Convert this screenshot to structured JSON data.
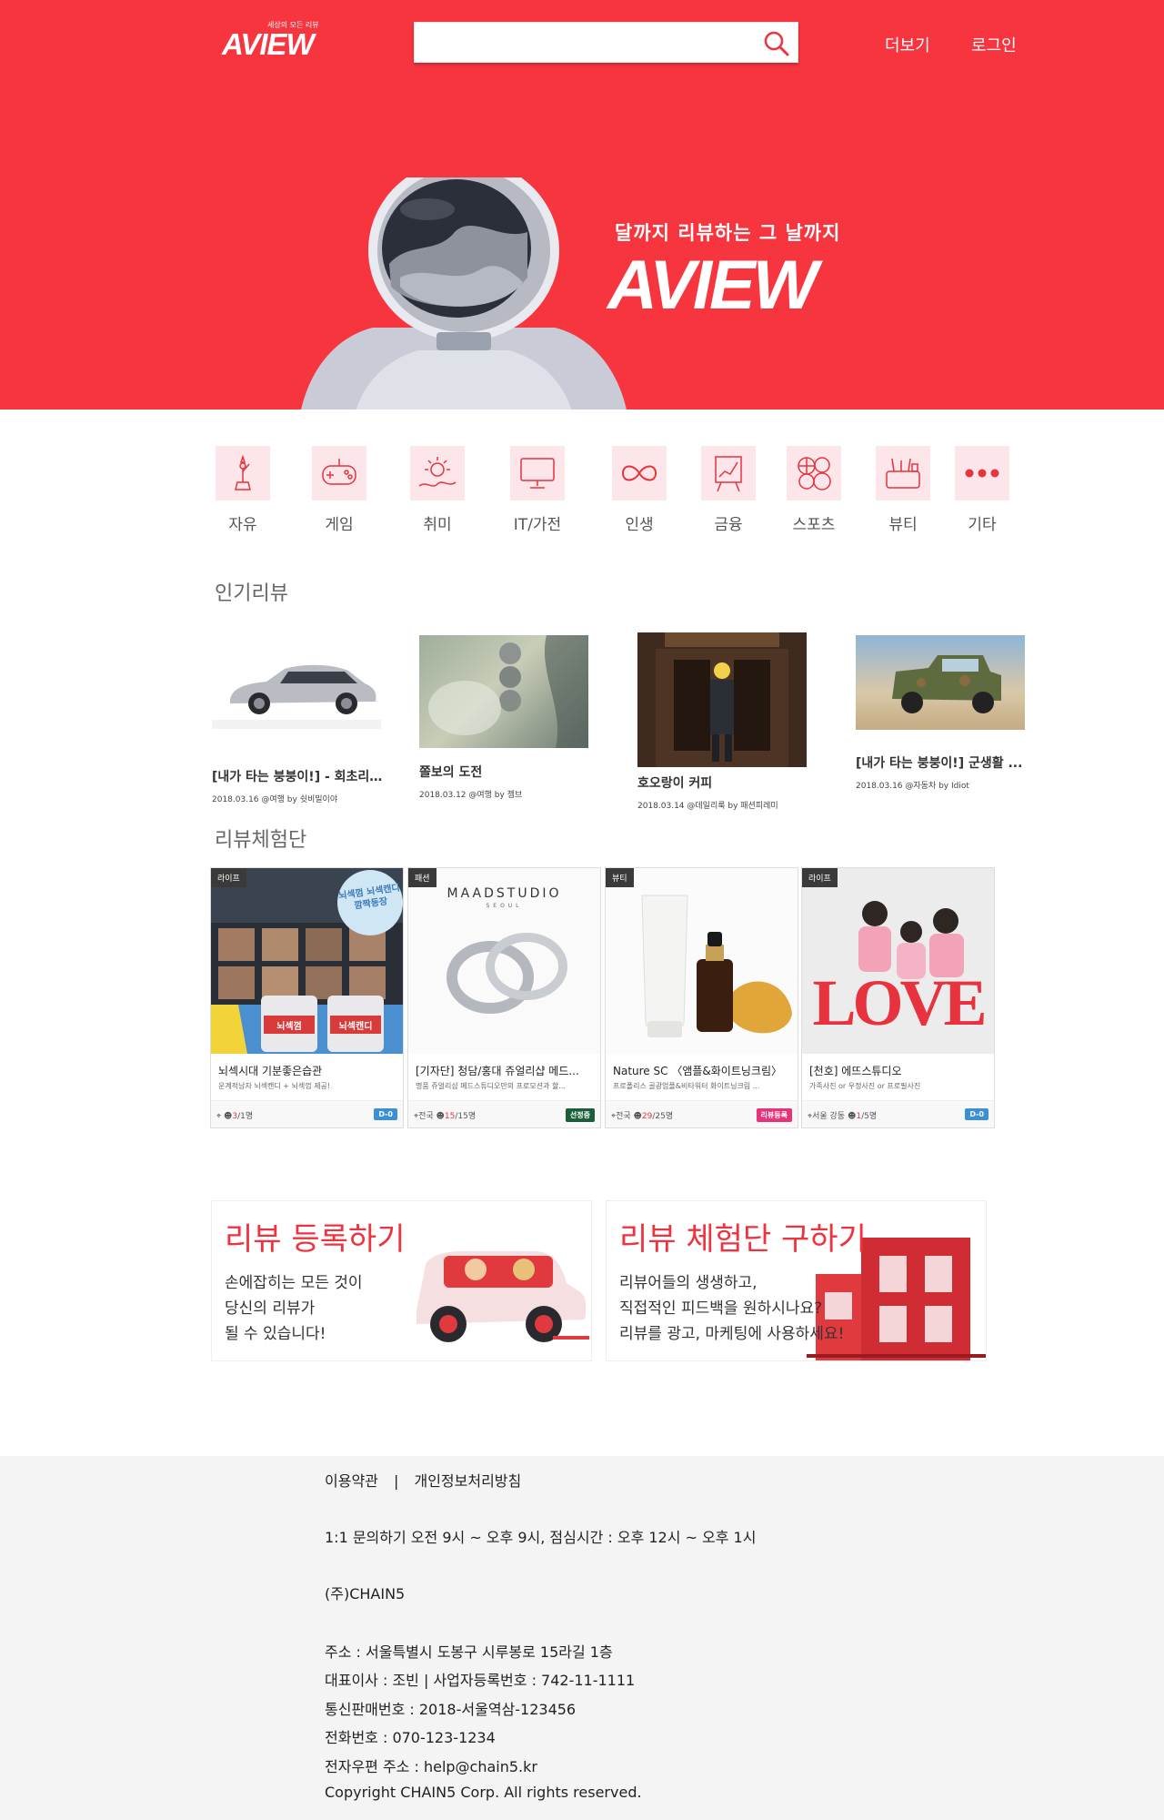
{
  "header": {
    "logo_text": "AVIEW",
    "logo_tagline": "세상의 모든 리뷰",
    "search_placeholder": "",
    "more_label": "더보기",
    "login_label": "로그인"
  },
  "hero": {
    "tagline": "달까지 리뷰하는 그 날까지",
    "logo_text": "AVIEW"
  },
  "categories": [
    {
      "label": "자유",
      "icon": "statue-of-liberty-icon"
    },
    {
      "label": "게임",
      "icon": "gamepad-icon"
    },
    {
      "label": "취미",
      "icon": "sun-icon"
    },
    {
      "label": "IT/가전",
      "icon": "monitor-icon"
    },
    {
      "label": "인생",
      "icon": "infinity-icon"
    },
    {
      "label": "금융",
      "icon": "chart-board-icon"
    },
    {
      "label": "스포츠",
      "icon": "sports-balls-icon"
    },
    {
      "label": "뷰티",
      "icon": "cosmetics-icon"
    },
    {
      "label": "기타",
      "icon": "more-dots-icon"
    }
  ],
  "popular": {
    "title": "인기리뷰",
    "items": [
      {
        "title": "[내가 타는 붕붕이!] - 회초리...",
        "meta": "2018.03.16 @여행 by 쉿비밀이야"
      },
      {
        "title": "쫄보의 도전",
        "meta": "2018.03.12 @여행 by 젬브"
      },
      {
        "title": "호오랑이 커피",
        "meta": "2018.03.14 @데일리룩 by 패션피레미"
      },
      {
        "title": "[내가 타는 붕붕이!] 군생활 ...",
        "meta": "2018.03.16 @자동차 by Idiot"
      }
    ]
  },
  "experience": {
    "title": "리뷰체험단",
    "cards": [
      {
        "badge": "라이프",
        "title": "뇌섹시대 기분좋은습관",
        "desc": "운계적남자 뇌섹캔디 + 뇌섹껌 제공!",
        "location": "",
        "count": "3",
        "total": "/1명",
        "status": "D-0",
        "status_color": "#3b8fd6"
      },
      {
        "badge": "패션",
        "title": "[기자단] 청담/홍대 쥬얼리샵 메드...",
        "desc": "명품 쥬얼리샵 메드스튜디오만의 프로모션과 할...",
        "location": "전국",
        "count": "15",
        "total": "/15명",
        "status": "선정중",
        "status_color": "#1a5e3a"
      },
      {
        "badge": "뷰티",
        "title": "Nature SC 〈앰플&화이트닝크림〉",
        "desc": "프로폴리스 골광엄플&비타워터 화이트닝크림 ...",
        "location": "전국",
        "count": "29",
        "total": "/25명",
        "status": "리뷰등록",
        "status_color": "#e8327a"
      },
      {
        "badge": "라이프",
        "title": "[천호] 에뜨스튜디오",
        "desc": "가족사진 or 우정사진 or 프로필사진",
        "location": "서울 강동",
        "count": "1",
        "total": "/5명",
        "status": "D-0",
        "status_color": "#3b8fd6"
      }
    ],
    "card_images": {
      "card1_bubble": "뇌섹껌 뇌섹캔디 깜짝등장",
      "card1_jar_a": "뇌섹껌",
      "card1_jar_b": "뇌섹캔디",
      "card2_brand": "MAADSTUDIO",
      "card2_sub": "SEOUL",
      "card4_word": "LOVE"
    }
  },
  "promos": [
    {
      "heading": "리뷰 등록하기",
      "lines": [
        "손에잡히는 모든 것이",
        "당신의 리뷰가",
        "될 수 있습니다!"
      ]
    },
    {
      "heading": "리뷰 체험단 구하기",
      "lines": [
        "리뷰어들의 생생하고,",
        "직접적인 피드백을 원하시나요?",
        "리뷰를 광고, 마케팅에 사용하세요!"
      ]
    }
  ],
  "footer": {
    "terms": "이용약관",
    "separator": "|",
    "privacy": "개인정보처리방침",
    "hours": "1:1 문의하기 오전 9시 ~ 오후 9시, 점심시간 : 오후 12시 ~ 오후 1시",
    "company": "(주)CHAIN5",
    "address": "주소 : 서울특별시 도봉구 시루봉로 15라길 1층",
    "ceo": "대표이사 : 조빈  |  사업자등록번호 : 742-11-1111",
    "ecommerce": "통신판매번호 : 2018-서울역삼-123456",
    "phone": "전화번호 : 070-123-1234",
    "email": "전자우편 주소 : help@chain5.kr",
    "copyright": "Copyright CHAIN5 Corp. All rights reserved."
  },
  "colors": {
    "brand": "#f7353f",
    "category_bg": "#fde6e9",
    "promo_heading": "#f0323e"
  }
}
